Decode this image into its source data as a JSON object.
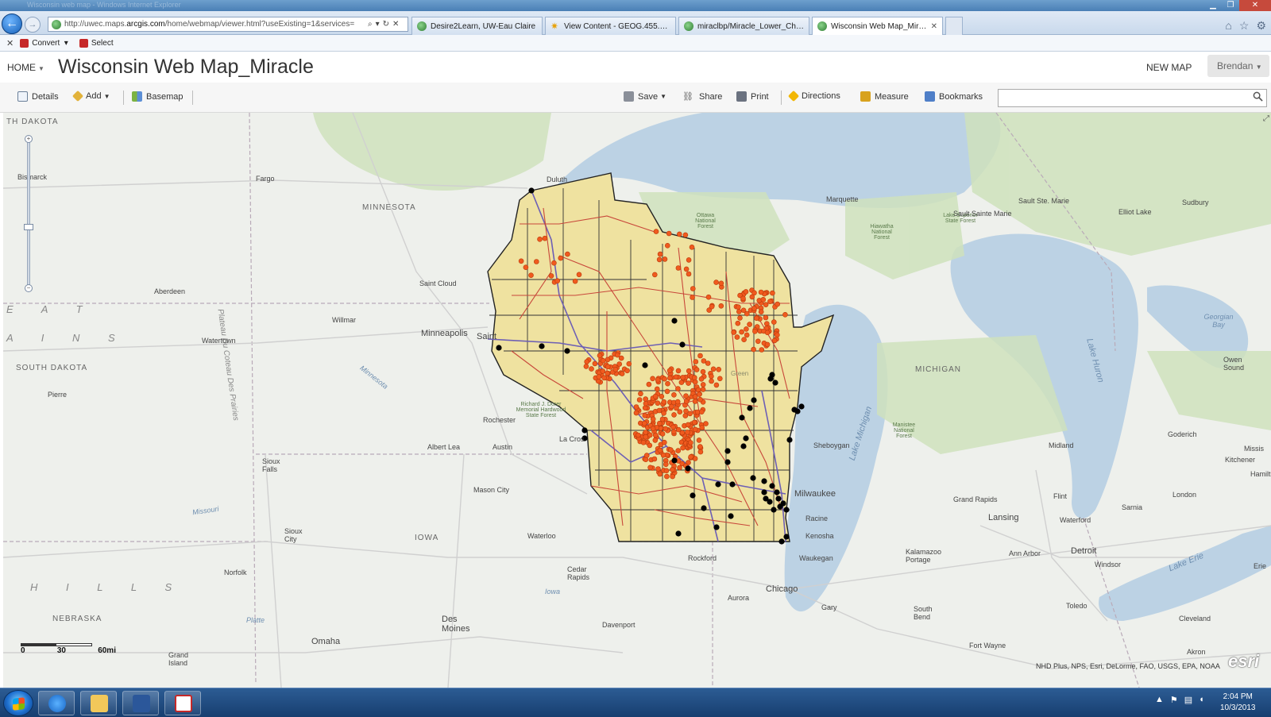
{
  "browser": {
    "title_ghost": "Wisconsin web map - Windows Internet Explorer",
    "url_prefix": "http://uwec.maps.",
    "url_host": "arcgis.com",
    "url_rest": "/home/webmap/viewer.html?useExisting=1&services=",
    "tabs": [
      {
        "label": "Desire2Learn, UW-Eau Claire",
        "active": false
      },
      {
        "label": "View Content - GEOG.455.001 ...",
        "active": false
      },
      {
        "label": "miraclbp/Miracle_Lower_Chip...",
        "active": false
      },
      {
        "label": "Wisconsin Web Map_Miracle",
        "active": true
      }
    ],
    "command_bar": {
      "convert_label": "Convert",
      "select_label": "Select"
    }
  },
  "header": {
    "home_label": "HOME",
    "title": "Wisconsin Web Map_Miracle",
    "new_map_label": "NEW MAP",
    "user_label": "Brendan"
  },
  "toolbar": {
    "details_label": "Details",
    "add_label": "Add",
    "basemap_label": "Basemap",
    "save_label": "Save",
    "share_label": "Share",
    "print_label": "Print",
    "directions_label": "Directions",
    "measure_label": "Measure",
    "bookmarks_label": "Bookmarks",
    "search_value": ""
  },
  "map": {
    "state_labels": {
      "north_dakota": "TH DAKOTA",
      "minnesota": "MINNESOTA",
      "south_dakota": "SOUTH DAKOTA",
      "iowa": "IOWA",
      "michigan": "MICHIGAN",
      "nebraska": "NEBRASKA"
    },
    "region_labels": {
      "great": "E A T",
      "plains": "A I N S",
      "hills": "H I L L S"
    },
    "water_labels": {
      "lake_michigan": "Lake Michigan",
      "lake_huron": "Lake Huron",
      "lake_erie": "Lake Erie",
      "georgian_bay": "Georgian Bay",
      "plateau": "Plateau Du Coteau Des Prairies",
      "minnesota_river": "Minnesota",
      "missouri": "Missouri",
      "platte": "Platte",
      "iowa_river": "Iowa"
    },
    "places": {
      "bismarck": "Bismarck",
      "fargo": "Fargo",
      "duluth": "Duluth",
      "marquette": "Marquette",
      "sault_ste_marie": "Sault Ste. Marie",
      "sault_sainte_marie": "Sault Sainte Marie",
      "elliot_lake": "Elliot Lake",
      "sudbury": "Sudbury",
      "aberdeen": "Aberdeen",
      "saint_cloud": "Saint Cloud",
      "willmar": "Willmar",
      "minneapolis": "Minneapolis",
      "saint": "Saint",
      "watertown": "Watertown",
      "pierre": "Pierre",
      "rochester": "Rochester",
      "albert_lea": "Albert Lea",
      "austin": "Austin",
      "la_crosse": "La Cros",
      "sioux_falls": "Sioux Falls",
      "mason_city": "Mason City",
      "waterloo": "Waterloo",
      "sioux_city": "Sioux City",
      "norfolk": "Norfolk",
      "cedar_rapids": "Cedar Rapids",
      "rockford": "Rockford",
      "aurora": "Aurora",
      "chicago": "Chicago",
      "gary": "Gary",
      "davenport": "Davenport",
      "des_moines": "Des Moines",
      "omaha": "Omaha",
      "grand_island": "Grand Island",
      "milwaukee": "Milwaukee",
      "racine": "Racine",
      "kenosha": "Kenosha",
      "waukegan": "Waukegan",
      "sheboygan": "Sheboygan",
      "grand_rapids": "Grand Rapids",
      "lansing": "Lansing",
      "flint": "Flint",
      "waterford": "Waterford",
      "midland": "Midland",
      "goderich": "Goderich",
      "kitchener": "Kitchener",
      "london": "London",
      "sarnia": "Sarnia",
      "kalamazoo": "Kalamazoo Portage",
      "ann_arbor": "Ann Arbor",
      "detroit": "Detroit",
      "windsor": "Windsor",
      "toledo": "Toledo",
      "south_bend": "South Bend",
      "fort_wayne": "Fort Wayne",
      "cleveland": "Cleveland",
      "akron": "Akron",
      "owen_sound": "Owen Sound",
      "erie": "Erie",
      "hamilton": "Hamilt",
      "mississauga": "Missis"
    },
    "forest_labels": {
      "ottawa": "Ottawa National Forest",
      "hiawatha": "Hiawatha National Forest",
      "lake_superior": "Lake Superior State Forest",
      "richard_dorer": "Richard J. Dorer Memorial Hardwood State Forest",
      "manistee": "Manistee National Forest",
      "green": "Green"
    },
    "scale": {
      "zero": "0",
      "mid": "30",
      "max": "60mi"
    },
    "attribution": "NHD Plus, NPS, Esri, DeLorme, FAO, USGS, EPA, NOAA",
    "logo": "esri"
  },
  "taskbar": {
    "time": "2:04 PM",
    "date": "10/3/2013"
  },
  "colors": {
    "state_fill": "#efe2a0",
    "orange_points": "#f05a1e",
    "black_points": "#000000",
    "water": "#bcd2e4"
  }
}
